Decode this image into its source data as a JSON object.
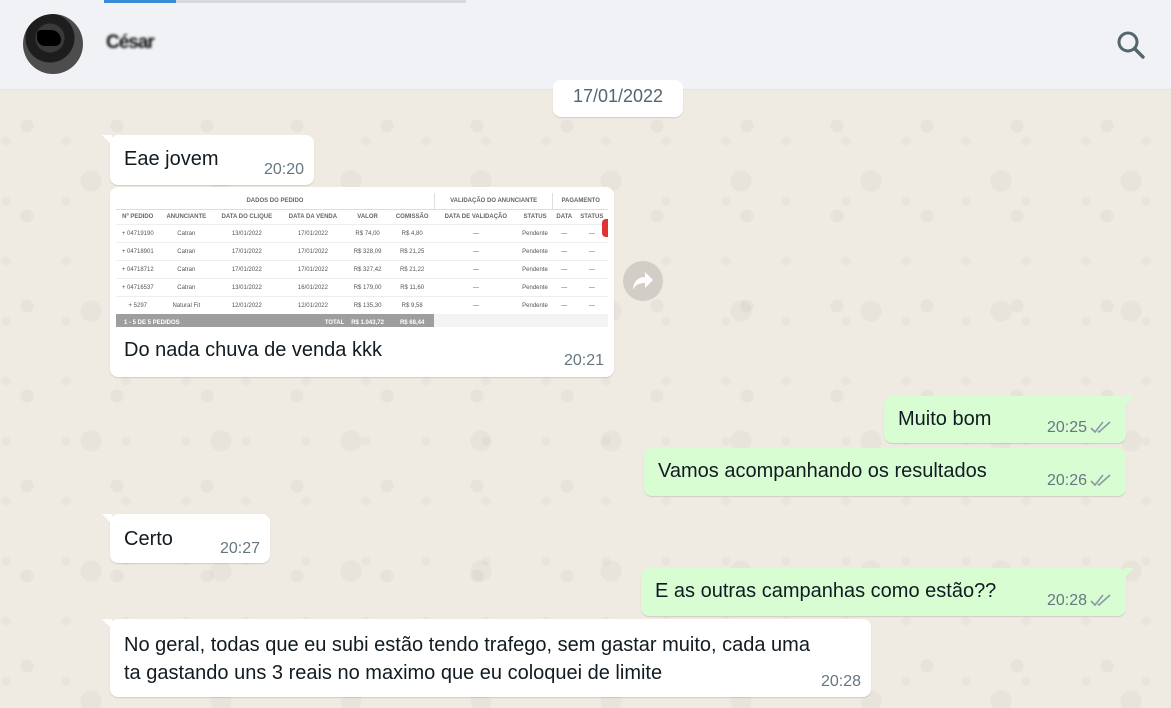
{
  "header": {
    "contact_name": "César",
    "search_icon": "search-icon"
  },
  "date_chip": "17/01/2022",
  "messages": [
    {
      "direction": "in",
      "text": "Eae jovem",
      "time": "20:20"
    },
    {
      "direction": "in",
      "type": "image",
      "caption": "Do nada chuva de venda kkk",
      "time": "20:21",
      "image": {
        "group_headers": [
          "DADOS DO PEDIDO",
          "VALIDAÇÃO DO ANUNCIANTE",
          "PAGAMENTO"
        ],
        "columns": [
          "Nº PEDIDO",
          "ANUNCIANTE",
          "DATA DO CLIQUE",
          "DATA DA VENDA",
          "VALOR",
          "COMISSÃO",
          "DATA DE VALIDAÇÃO",
          "STATUS",
          "DATA",
          "STATUS"
        ],
        "rows": [
          [
            "+ 04719190",
            "Catran",
            "13/01/2022",
            "17/01/2022",
            "R$ 74,00",
            "R$ 4,80",
            "—",
            "Pendente",
            "—",
            "—"
          ],
          [
            "+ 04718901",
            "Catran",
            "17/01/2022",
            "17/01/2022",
            "R$ 328,09",
            "R$ 21,25",
            "—",
            "Pendente",
            "—",
            "—"
          ],
          [
            "+ 04718712",
            "Catran",
            "17/01/2022",
            "17/01/2022",
            "R$ 327,42",
            "R$ 21,22",
            "—",
            "Pendente",
            "—",
            "—"
          ],
          [
            "+ 04716537",
            "Catran",
            "13/01/2022",
            "16/01/2022",
            "R$ 179,00",
            "R$ 11,60",
            "—",
            "Pendente",
            "—",
            "—"
          ],
          [
            "+ 5297",
            "Natural Fit",
            "12/01/2022",
            "12/01/2022",
            "R$ 135,30",
            "R$ 9,58",
            "—",
            "Pendente",
            "—",
            "—"
          ]
        ],
        "footer": {
          "range": "1 - 5 DE 5 PEDIDOS",
          "total_label": "TOTAL",
          "total_value": "R$ 1.043,72",
          "total_commission": "R$ 68,44"
        }
      }
    },
    {
      "direction": "out",
      "text": "Muito bom",
      "time": "20:25",
      "status": "read"
    },
    {
      "direction": "out",
      "text": "Vamos acompanhando os resultados",
      "time": "20:26",
      "status": "read"
    },
    {
      "direction": "in",
      "text": "Certo",
      "time": "20:27"
    },
    {
      "direction": "out",
      "text": "E as outras campanhas como estão??",
      "time": "20:28",
      "status": "read"
    },
    {
      "direction": "in",
      "text": "No geral, todas que eu subi estão tendo trafego, sem gastar muito, cada uma\nta gastando uns 3 reais no maximo que eu coloquei de limite",
      "time": "20:28"
    }
  ],
  "colors": {
    "incoming_bubble": "#ffffff",
    "outgoing_bubble": "#d9fdd3",
    "chat_background": "#efeae2",
    "header_background": "#f0f2f5",
    "read_ticks": "#8a9aa4"
  }
}
